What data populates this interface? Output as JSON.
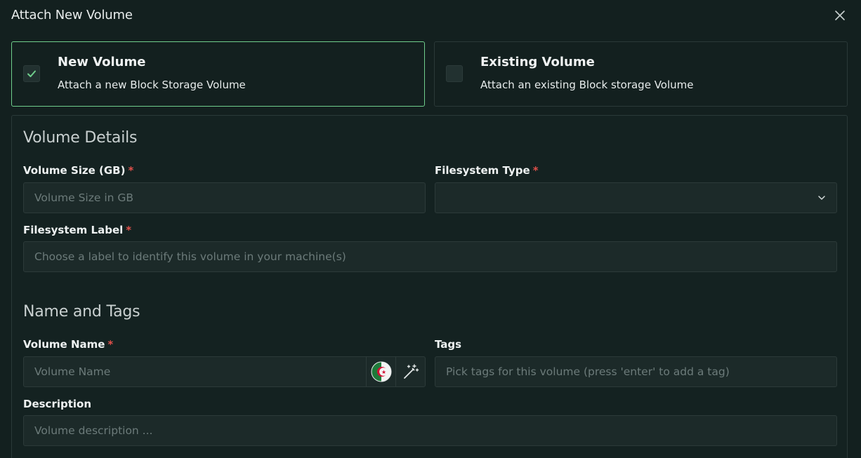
{
  "dialog": {
    "title": "Attach New Volume",
    "close_icon": "close-icon"
  },
  "options": {
    "new": {
      "title": "New Volume",
      "description": "Attach a new Block Storage Volume",
      "checked": true
    },
    "existing": {
      "title": "Existing Volume",
      "description": "Attach an existing Block storage Volume",
      "checked": false
    }
  },
  "volume_details": {
    "heading": "Volume Details",
    "size": {
      "label": "Volume Size (GB)",
      "required": "*",
      "placeholder": "Volume Size in GB",
      "value": ""
    },
    "fs_type": {
      "label": "Filesystem Type",
      "required": "*",
      "value": ""
    },
    "fs_label": {
      "label": "Filesystem Label",
      "required": "*",
      "placeholder": "Choose a label to identify this volume in your machine(s)",
      "value": ""
    }
  },
  "name_tags": {
    "heading": "Name and Tags",
    "name": {
      "label": "Volume Name",
      "required": "*",
      "placeholder": "Volume Name",
      "value": ""
    },
    "tags": {
      "label": "Tags",
      "placeholder": "Pick tags for this volume (press 'enter' to add a tag)"
    },
    "description": {
      "label": "Description",
      "placeholder": "Volume description ..."
    }
  },
  "colors": {
    "accent": "#6fce8c",
    "required": "#e0504a",
    "background": "#13201f"
  }
}
